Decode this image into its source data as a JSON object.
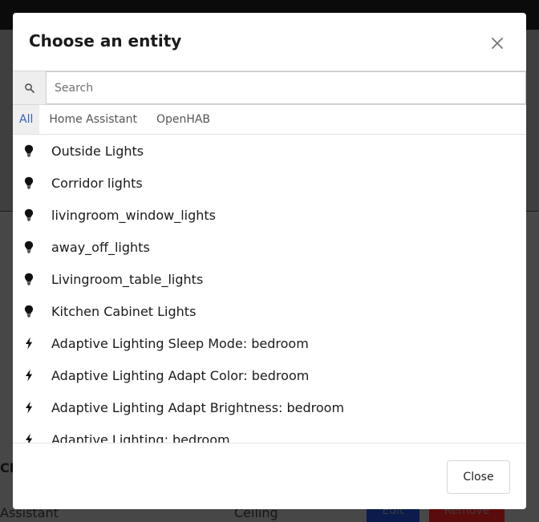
{
  "background": {
    "section_heading": "CE",
    "row": {
      "name": "Assistant",
      "location": "Ceiling",
      "edit_label": "Edit",
      "remove_label": "Remove"
    }
  },
  "dialog": {
    "title": "Choose an entity",
    "search": {
      "placeholder": "Search",
      "value": ""
    },
    "tabs": [
      {
        "label": "All",
        "active": true
      },
      {
        "label": "Home Assistant",
        "active": false
      },
      {
        "label": "OpenHAB",
        "active": false
      }
    ],
    "items": [
      {
        "label": "Outside Lights",
        "icon": "lightbulb-icon"
      },
      {
        "label": "Corridor lights",
        "icon": "lightbulb-icon"
      },
      {
        "label": "livingroom_window_lights",
        "icon": "lightbulb-icon"
      },
      {
        "label": "away_off_lights",
        "icon": "lightbulb-icon"
      },
      {
        "label": "Livingroom_table_lights",
        "icon": "lightbulb-icon"
      },
      {
        "label": "Kitchen Cabinet Lights",
        "icon": "lightbulb-icon"
      },
      {
        "label": "Adaptive Lighting Sleep Mode: bedroom",
        "icon": "bolt-icon"
      },
      {
        "label": "Adaptive Lighting Adapt Color: bedroom",
        "icon": "bolt-icon"
      },
      {
        "label": "Adaptive Lighting Adapt Brightness: bedroom",
        "icon": "bolt-icon"
      },
      {
        "label": "Adaptive Lighting: bedroom",
        "icon": "bolt-icon"
      }
    ],
    "close_label": "Close"
  },
  "colors": {
    "accent": "#2f5fbf",
    "overlay": "#4d4d4d",
    "dialog_bg": "#ffffff"
  }
}
